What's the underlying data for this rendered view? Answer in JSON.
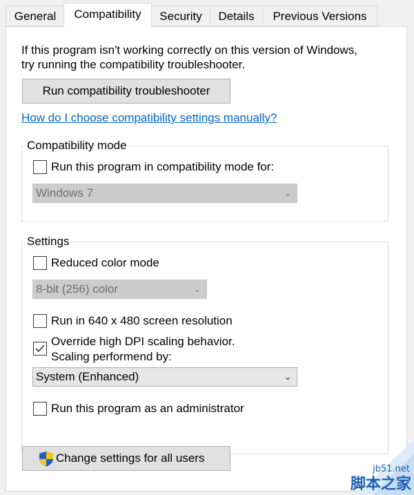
{
  "tabs": [
    "General",
    "Compatibility",
    "Security",
    "Details",
    "Previous Versions"
  ],
  "intro": {
    "line1": "If this program isn't working correctly on this version of Windows,",
    "line2": "try running the compatibility troubleshooter."
  },
  "troubleshoot_button": "Run compatibility troubleshooter",
  "manual_link": "How do I choose compatibility settings manually?",
  "compat_mode": {
    "title": "Compatibility mode",
    "checkbox_label": "Run this program in compatibility mode for:",
    "checked": false,
    "select_value": "Windows 7"
  },
  "settings": {
    "title": "Settings",
    "reduced_color": {
      "label": "Reduced color mode",
      "checked": false
    },
    "color_select": "8-bit (256) color",
    "res640": {
      "label": "Run in 640 x 480 screen resolution",
      "checked": false
    },
    "dpi": {
      "label_line1": "Override high DPI scaling behavior.",
      "label_line2": "Scaling performend by:",
      "checked": true
    },
    "dpi_select": "System (Enhanced)",
    "admin": {
      "label": "Run this program as an administrator",
      "checked": false
    }
  },
  "change_all_button": "Change settings for all users",
  "watermark": {
    "site": "jb51.net",
    "text": "脚本之家"
  },
  "colors": {
    "link": "#0066cc",
    "panel": "#ffffff",
    "window": "#f0f0f0",
    "shield_blue": "#1f5fbf",
    "shield_yellow": "#f5c518"
  }
}
